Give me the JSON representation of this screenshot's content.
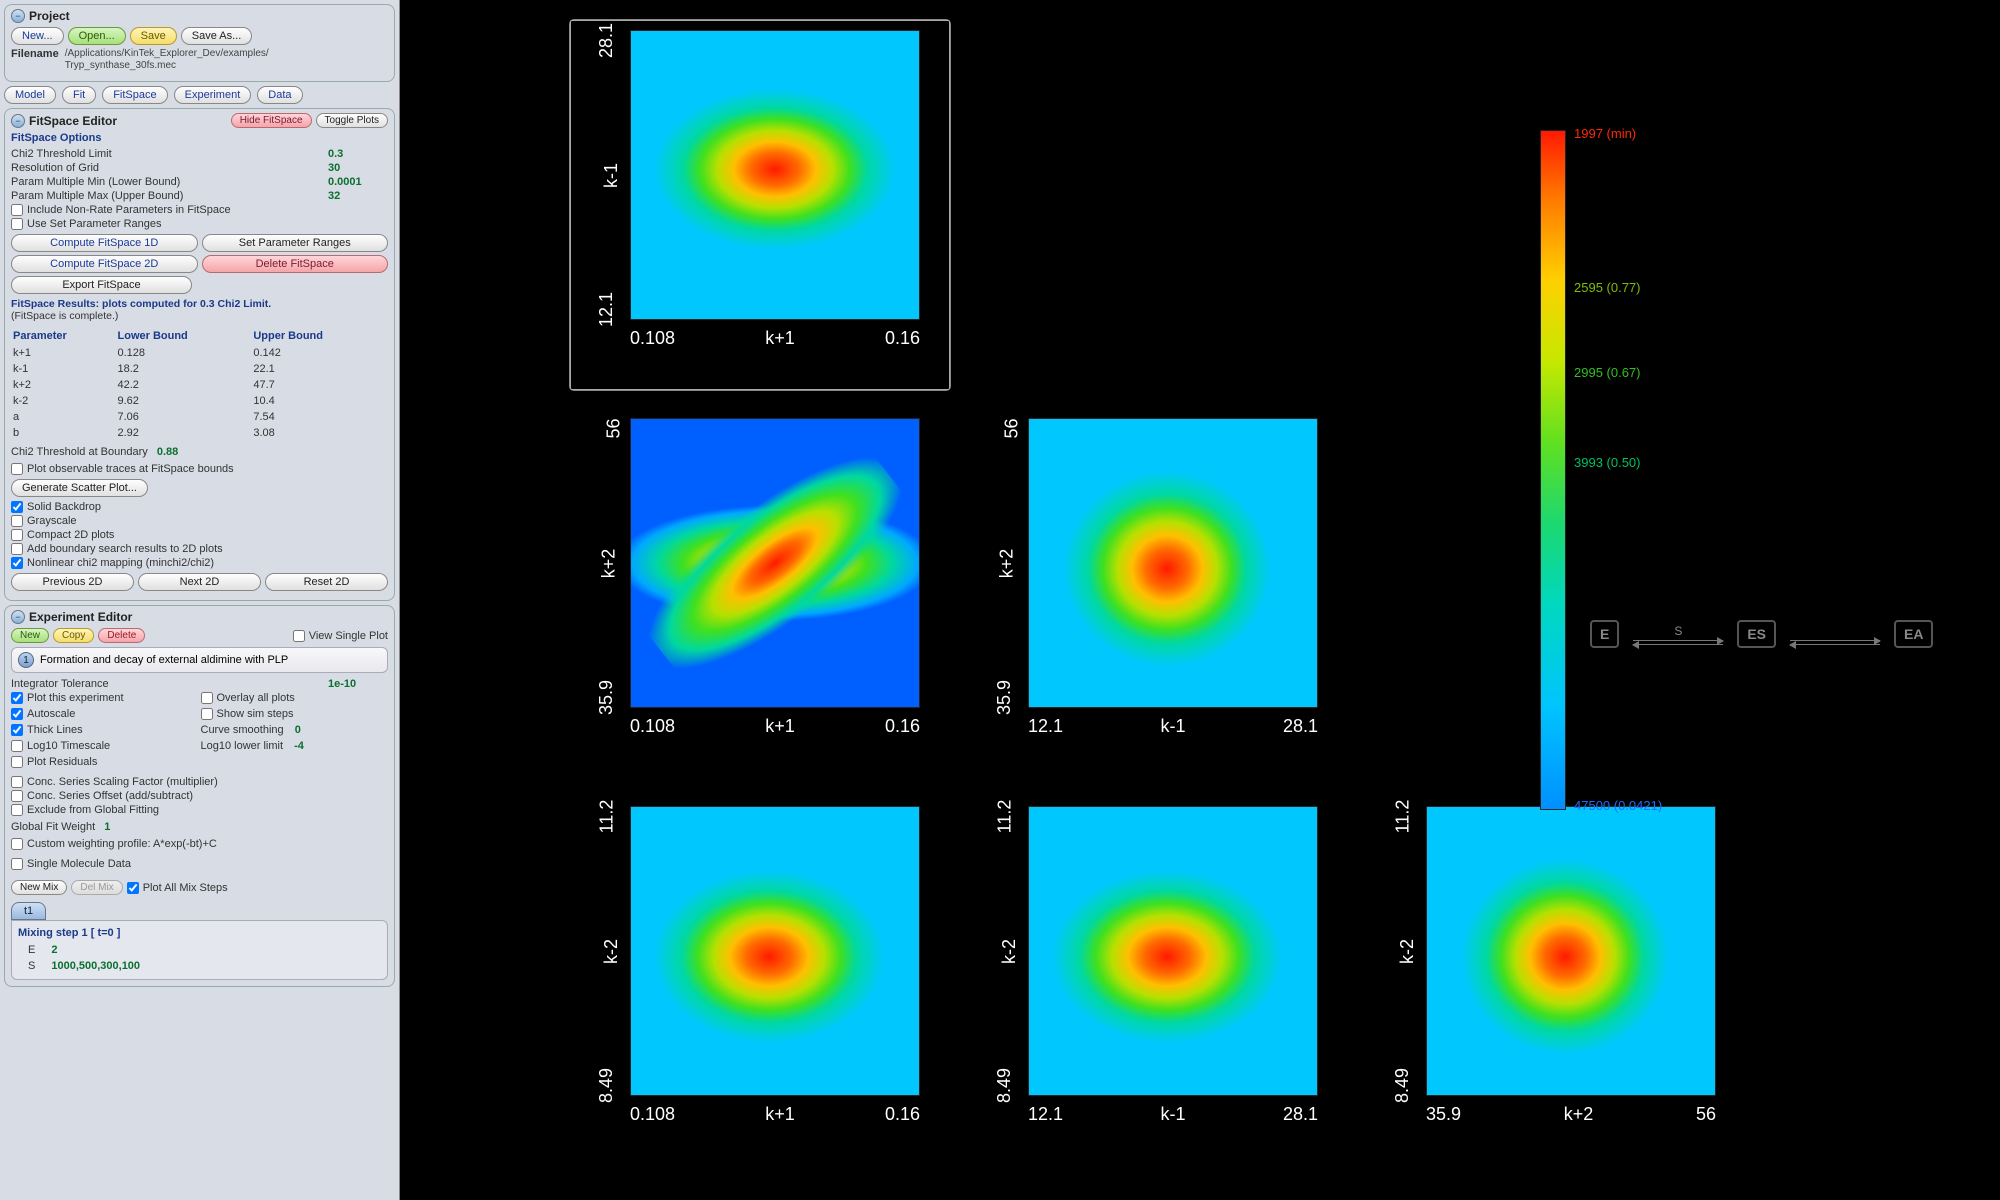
{
  "project": {
    "title": "Project",
    "new": "New...",
    "open": "Open...",
    "save": "Save",
    "saveas": "Save As...",
    "filename_label": "Filename",
    "path1": "/Applications/KinTek_Explorer_Dev/examples/",
    "path2": "Tryp_synthase_30fs.mec"
  },
  "tabs": {
    "model": "Model",
    "fit": "Fit",
    "fitspace": "FitSpace",
    "experiment": "Experiment",
    "data": "Data"
  },
  "fs": {
    "title": "FitSpace Editor",
    "hide": "Hide FitSpace",
    "toggle": "Toggle Plots",
    "opts_title": "FitSpace Options",
    "chi2_lim_k": "Chi2 Threshold Limit",
    "chi2_lim_v": "0.3",
    "res_k": "Resolution of Grid",
    "res_v": "30",
    "pmin_k": "Param Multiple Min (Lower Bound)",
    "pmin_v": "0.0001",
    "pmax_k": "Param Multiple Max (Upper Bound)",
    "pmax_v": "32",
    "cb_nonrate": "Include Non-Rate Parameters in FitSpace",
    "cb_useset": "Use Set Parameter Ranges",
    "compute1d": "Compute FitSpace 1D",
    "setranges": "Set Parameter Ranges",
    "compute2d": "Compute FitSpace 2D",
    "delete": "Delete FitSpace",
    "export": "Export FitSpace",
    "results1": "FitSpace Results: plots computed for 0.3 Chi2 Limit.",
    "results2": "(FitSpace is complete.)",
    "th_param": "Parameter",
    "th_lb": "Lower Bound",
    "th_ub": "Upper Bound",
    "params": [
      {
        "p": "k+1",
        "lb": "0.128",
        "ub": "0.142"
      },
      {
        "p": "k-1",
        "lb": "18.2",
        "ub": "22.1"
      },
      {
        "p": "k+2",
        "lb": "42.2",
        "ub": "47.7"
      },
      {
        "p": "k-2",
        "lb": "9.62",
        "ub": "10.4"
      },
      {
        "p": "a",
        "lb": "7.06",
        "ub": "7.54"
      },
      {
        "p": "b",
        "lb": "2.92",
        "ub": "3.08"
      }
    ],
    "chi2_bound_k": "Chi2 Threshold at Boundary",
    "chi2_bound_v": "0.88",
    "cb_obs": "Plot observable traces at FitSpace bounds",
    "scatter": "Generate Scatter Plot...",
    "cb_solid": "Solid Backdrop",
    "cb_gray": "Grayscale",
    "cb_compact": "Compact 2D plots",
    "cb_addbound": "Add boundary search results to 2D plots",
    "cb_nonlinear": "Nonlinear chi2 mapping (minchi2/chi2)",
    "prev2d": "Previous 2D",
    "next2d": "Next 2D",
    "reset2d": "Reset 2D"
  },
  "ee": {
    "title": "Experiment Editor",
    "new": "New",
    "copy": "Copy",
    "delete": "Delete",
    "view": "View Single Plot",
    "entry_num": "1",
    "entry_text": "Formation and decay of external aldimine with PLP",
    "inttol_k": "Integrator Tolerance",
    "inttol_v": "1e-10",
    "cb_plotexp": "Plot this experiment",
    "cb_overlay": "Overlay all plots",
    "cb_auto": "Autoscale",
    "cb_showsim": "Show sim steps",
    "cb_thick": "Thick Lines",
    "curvesm_k": "Curve smoothing",
    "curvesm_v": "0",
    "cb_log10t": "Log10 Timescale",
    "log10ll_k": "Log10 lower limit",
    "log10ll_v": "-4",
    "cb_plotres": "Plot Residuals",
    "cb_conc_scale": "Conc. Series Scaling Factor (multiplier)",
    "cb_conc_off": "Conc. Series Offset (add/subtract)",
    "cb_excl": "Exclude from Global Fitting",
    "gfw_k": "Global Fit Weight",
    "gfw_v": "1",
    "cb_custom": "Custom weighting profile: A*exp(-bt)+C",
    "cb_single": "Single Molecule Data",
    "newmix": "New Mix",
    "delmix": "Del Mix",
    "cb_plotall": "Plot All Mix Steps",
    "t1": "t1",
    "mix_header": "Mixing step 1 [ t=0 ]",
    "mix_E_k": "E",
    "mix_E_v": "2",
    "mix_S_k": "S",
    "mix_S_v": "1000,500,300,100"
  },
  "colorbar": {
    "tick_min": "1997 (min)",
    "tick_77": "2595 (0.77)",
    "tick_67": "2995 (0.67)",
    "tick_50": "3993 (0.50)",
    "tick_bot": "47500 (0.0421)"
  },
  "reaction": {
    "n1": "E",
    "s": "S",
    "n2": "ES",
    "n3": "EA"
  },
  "chart_data": [
    {
      "type": "heatmap",
      "x_param": "k+1",
      "y_param": "k-1",
      "x_range": [
        0.108,
        0.16
      ],
      "y_range": [
        12.1,
        28.1
      ],
      "note": "chi2 surface; min near center",
      "selected": true
    },
    {
      "type": "heatmap",
      "x_param": "k+1",
      "y_param": "k+2",
      "x_range": [
        0.108,
        0.16
      ],
      "y_range": [
        35.9,
        56
      ],
      "note": "diagonal anti-correlation"
    },
    {
      "type": "heatmap",
      "x_param": "k-1",
      "y_param": "k+2",
      "x_range": [
        12.1,
        28.1
      ],
      "y_range": [
        35.9,
        56
      ]
    },
    {
      "type": "heatmap",
      "x_param": "k+1",
      "y_param": "k-2",
      "x_range": [
        0.108,
        0.16
      ],
      "y_range": [
        8.49,
        11.2
      ]
    },
    {
      "type": "heatmap",
      "x_param": "k-1",
      "y_param": "k-2",
      "x_range": [
        12.1,
        28.1
      ],
      "y_range": [
        8.49,
        11.2
      ]
    },
    {
      "type": "heatmap",
      "x_param": "k+2",
      "y_param": "k-2",
      "x_range": [
        35.9,
        56
      ],
      "y_range": [
        8.49,
        11.2
      ]
    }
  ],
  "plots": [
    {
      "xl": "0.108",
      "xn": "k+1",
      "xr": "0.16",
      "yb": "12.1",
      "yn": "k-1",
      "yt": "28.1",
      "cls": "g-tilt1",
      "sel": true
    },
    {
      "xl": "0.108",
      "xn": "k+1",
      "xr": "0.16",
      "yb": "35.9",
      "yn": "k+2",
      "yt": "56",
      "cls": "g-diag"
    },
    {
      "xl": "12.1",
      "xn": "k-1",
      "xr": "28.1",
      "yb": "35.9",
      "yn": "k+2",
      "yt": "56",
      "cls": "g-round"
    },
    {
      "xl": "0.108",
      "xn": "k+1",
      "xr": "0.16",
      "yb": "8.49",
      "yn": "k-2",
      "yt": "11.2",
      "cls": "g-slight"
    },
    {
      "xl": "12.1",
      "xn": "k-1",
      "xr": "28.1",
      "yb": "8.49",
      "yn": "k-2",
      "yt": "11.2",
      "cls": "g-slight"
    },
    {
      "xl": "35.9",
      "xn": "k+2",
      "xr": "56",
      "yb": "8.49",
      "yn": "k-2",
      "yt": "11.2",
      "cls": "g-round"
    }
  ]
}
